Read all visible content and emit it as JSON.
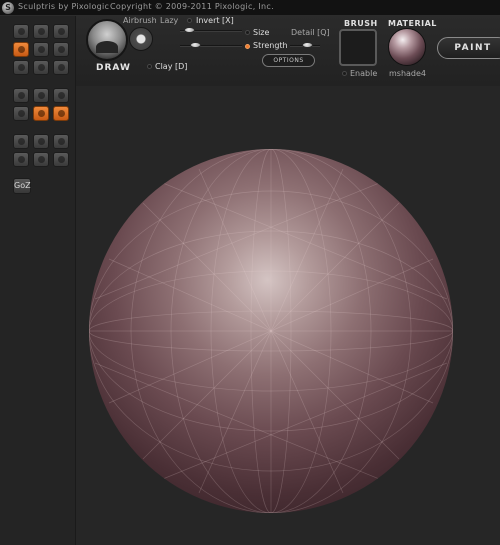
{
  "window": {
    "title": "Sculptris by Pixologic",
    "copyright": "Copyright © 2009-2011 Pixologic, Inc."
  },
  "toolbar": {
    "active_brush": "DRAW",
    "airbrush_label": "Airbrush",
    "lazy_label": "Lazy",
    "invert_label": "Invert [X]",
    "clay_label": "Clay [D]",
    "size_label": "Size",
    "strength_label": "Strength",
    "detail_label": "Detail [Q]",
    "options_label": "OPTIONS",
    "brush_heading": "BRUSH",
    "brush_enable_label": "Enable",
    "material_heading": "MATERIAL",
    "material_name": "mshade4",
    "paint_label": "PAINT"
  },
  "sidebar": {
    "goz_label": "GoZ",
    "tools": [
      {
        "icon": "draw-icon",
        "active": false
      },
      {
        "icon": "flatten-icon",
        "active": false
      },
      {
        "icon": "crease-icon",
        "active": false
      },
      {
        "icon": "inflate-icon",
        "active": true
      },
      {
        "icon": "pinch-icon",
        "active": false
      },
      {
        "icon": "grab-icon",
        "active": false
      },
      {
        "icon": "smooth-icon",
        "active": false
      },
      {
        "icon": "reduce-icon",
        "active": false
      },
      {
        "icon": "mask-icon",
        "active": false
      },
      {
        "icon": "rotate-icon",
        "active": false
      },
      {
        "icon": "scale-icon",
        "active": false
      },
      {
        "icon": "move-icon",
        "active": false
      },
      {
        "icon": "wireframe-icon",
        "active": false
      },
      {
        "icon": "symmetry-icon",
        "active": true
      },
      {
        "icon": "mirror-icon",
        "active": true
      },
      {
        "icon": "material-preview-icon",
        "active": false
      },
      {
        "icon": "light-icon",
        "active": false
      },
      {
        "icon": "save-icon",
        "active": false
      },
      {
        "icon": "open-icon",
        "active": false
      },
      {
        "icon": "undo-icon",
        "active": false
      },
      {
        "icon": "redo-icon",
        "active": false
      }
    ]
  },
  "colors": {
    "accent": "#f07a2e",
    "background": "#232323",
    "material_tint": "#8d6f72"
  }
}
